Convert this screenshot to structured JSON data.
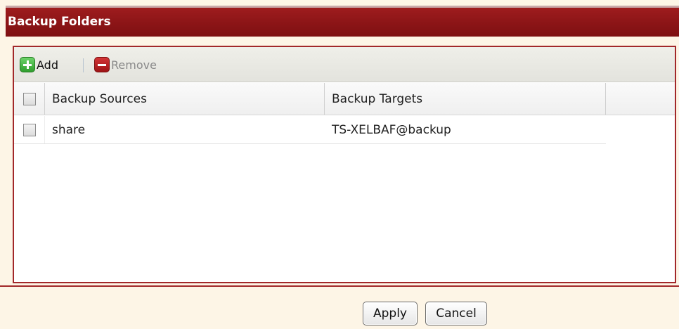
{
  "panel": {
    "title": "Backup Folders"
  },
  "toolbar": {
    "add_label": "Add",
    "remove_label": "Remove"
  },
  "grid": {
    "columns": [
      "Backup Sources",
      "Backup Targets"
    ],
    "rows": [
      {
        "source": "share",
        "target": "TS-XELBAF@backup",
        "checked": false
      }
    ]
  },
  "footer": {
    "apply_label": "Apply",
    "cancel_label": "Cancel"
  },
  "colors": {
    "title_bar": "#8a1416",
    "frame_border": "#a2282a",
    "background": "#fdf5e6"
  },
  "icons": {
    "add": "plus-icon",
    "remove": "minus-icon"
  }
}
